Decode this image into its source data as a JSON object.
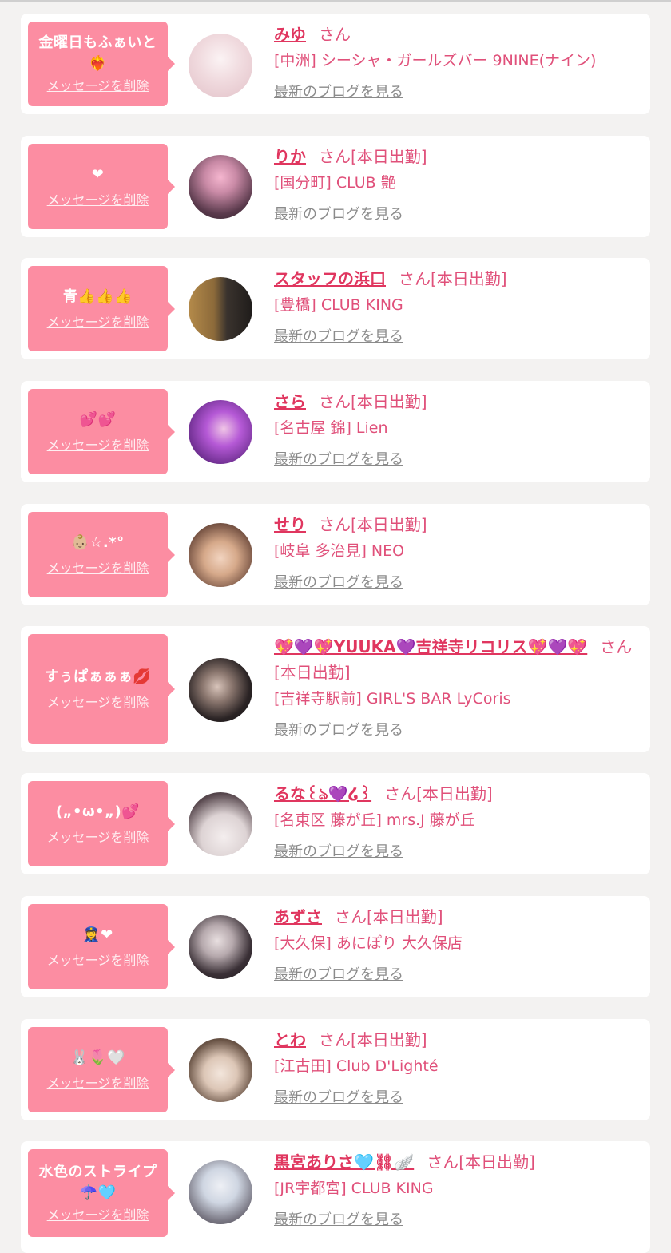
{
  "common": {
    "delete_label": "メッセージを削除",
    "blog_label": "最新のブログを見る",
    "san": "さん"
  },
  "colors": {
    "bubble": "#fc8da2",
    "name": "#e0365f",
    "text": "#e0507a",
    "link_gray": "#8b8b8b",
    "page_bg": "#f3f2f1"
  },
  "entries": [
    {
      "message": "金曜日もふぁいと❤️‍🔥",
      "name": "みゆ",
      "status": "",
      "store": "[中洲] シーシャ・ガールズバー 9NINE(ナイン)",
      "avatar_colors": [
        "#f6e8ea",
        "#e9c9cf"
      ]
    },
    {
      "message": "❤",
      "name": "りか",
      "status": "[本日出勤]",
      "store": "[国分町] CLUB 艶",
      "avatar_colors": [
        "#5e3a4e",
        "#f2a3c4"
      ]
    },
    {
      "message": "青👍👍👍",
      "name": "スタッフの浜口",
      "status": "[本日出勤]",
      "store": "[豊橋] CLUB KING",
      "avatar_colors": [
        "#9a7a3c",
        "#2f2a26"
      ]
    },
    {
      "message": "💕💕",
      "name": "さら",
      "status": "[本日出勤]",
      "store": "[名古屋 錦] Lien",
      "avatar_colors": [
        "#8c3fb8",
        "#d389e8"
      ]
    },
    {
      "message": "👶🏼☆.*°",
      "name": "せり",
      "status": "[本日出勤]",
      "store": "[岐阜 多治見] NEO",
      "avatar_colors": [
        "#d8b69a",
        "#5c4033"
      ]
    },
    {
      "message": "すぅぱぁぁぁ💋",
      "name": "💖💜💖YUUKA💜吉祥寺リコリス💖💜💖",
      "status": "[本日出勤]",
      "store": "[吉祥寺駅前] GIRL'S BAR LyCoris",
      "avatar_colors": [
        "#1f1b1c",
        "#c9b3a8"
      ]
    },
    {
      "message": "(„•ω•„)💕",
      "name": "るな꒰ঌ💜໒꒱",
      "status": "[本日出勤]",
      "store": "[名東区 藤が丘] mrs.J 藤が丘",
      "avatar_colors": [
        "#2a2228",
        "#e8e2e2"
      ]
    },
    {
      "message": "👮‍♀️❤",
      "name": "あずさ",
      "status": "[本日出勤]",
      "store": "[大久保] あにぽり 大久保店",
      "avatar_colors": [
        "#1c1a1d",
        "#d7cfd0"
      ]
    },
    {
      "message": "🐰🌷🤍",
      "name": "とわ",
      "status": "[本日出勤]",
      "store": "[江古田] Club D'Lighté",
      "avatar_colors": [
        "#e9e6e3",
        "#4a3a33"
      ]
    },
    {
      "message": "水色のストライプ☂️🩵",
      "name": "黒宮ありさ🩵⛓🪽",
      "status": "[本日出勤]",
      "store": "[JR宇都宮] CLUB KING",
      "avatar_colors": [
        "#cfd6e2",
        "#6f6f7c"
      ]
    }
  ]
}
